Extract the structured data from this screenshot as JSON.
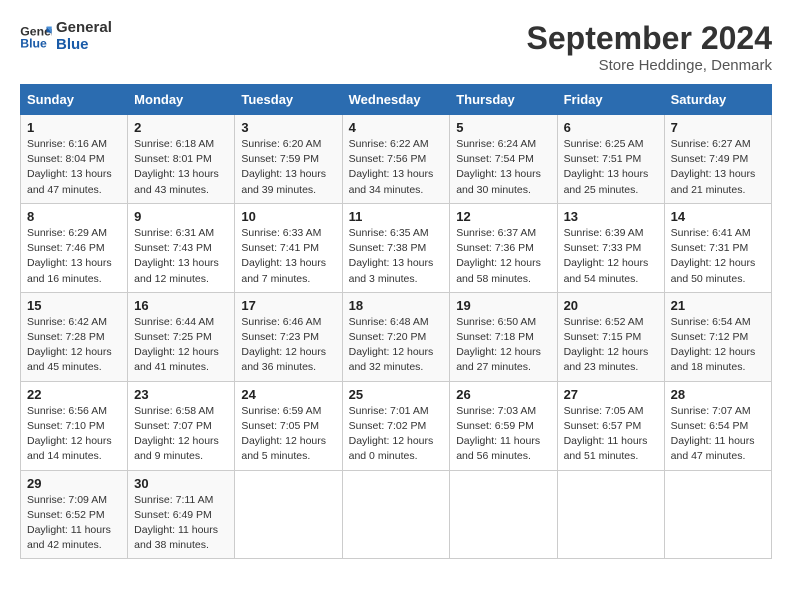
{
  "header": {
    "logo_line1": "General",
    "logo_line2": "Blue",
    "main_title": "September 2024",
    "subtitle": "Store Heddinge, Denmark"
  },
  "columns": [
    "Sunday",
    "Monday",
    "Tuesday",
    "Wednesday",
    "Thursday",
    "Friday",
    "Saturday"
  ],
  "weeks": [
    [
      {
        "day": "1",
        "sunrise": "6:16 AM",
        "sunset": "8:04 PM",
        "daylight": "13 hours and 47 minutes."
      },
      {
        "day": "2",
        "sunrise": "6:18 AM",
        "sunset": "8:01 PM",
        "daylight": "13 hours and 43 minutes."
      },
      {
        "day": "3",
        "sunrise": "6:20 AM",
        "sunset": "7:59 PM",
        "daylight": "13 hours and 39 minutes."
      },
      {
        "day": "4",
        "sunrise": "6:22 AM",
        "sunset": "7:56 PM",
        "daylight": "13 hours and 34 minutes."
      },
      {
        "day": "5",
        "sunrise": "6:24 AM",
        "sunset": "7:54 PM",
        "daylight": "13 hours and 30 minutes."
      },
      {
        "day": "6",
        "sunrise": "6:25 AM",
        "sunset": "7:51 PM",
        "daylight": "13 hours and 25 minutes."
      },
      {
        "day": "7",
        "sunrise": "6:27 AM",
        "sunset": "7:49 PM",
        "daylight": "13 hours and 21 minutes."
      }
    ],
    [
      {
        "day": "8",
        "sunrise": "6:29 AM",
        "sunset": "7:46 PM",
        "daylight": "13 hours and 16 minutes."
      },
      {
        "day": "9",
        "sunrise": "6:31 AM",
        "sunset": "7:43 PM",
        "daylight": "13 hours and 12 minutes."
      },
      {
        "day": "10",
        "sunrise": "6:33 AM",
        "sunset": "7:41 PM",
        "daylight": "13 hours and 7 minutes."
      },
      {
        "day": "11",
        "sunrise": "6:35 AM",
        "sunset": "7:38 PM",
        "daylight": "13 hours and 3 minutes."
      },
      {
        "day": "12",
        "sunrise": "6:37 AM",
        "sunset": "7:36 PM",
        "daylight": "12 hours and 58 minutes."
      },
      {
        "day": "13",
        "sunrise": "6:39 AM",
        "sunset": "7:33 PM",
        "daylight": "12 hours and 54 minutes."
      },
      {
        "day": "14",
        "sunrise": "6:41 AM",
        "sunset": "7:31 PM",
        "daylight": "12 hours and 50 minutes."
      }
    ],
    [
      {
        "day": "15",
        "sunrise": "6:42 AM",
        "sunset": "7:28 PM",
        "daylight": "12 hours and 45 minutes."
      },
      {
        "day": "16",
        "sunrise": "6:44 AM",
        "sunset": "7:25 PM",
        "daylight": "12 hours and 41 minutes."
      },
      {
        "day": "17",
        "sunrise": "6:46 AM",
        "sunset": "7:23 PM",
        "daylight": "12 hours and 36 minutes."
      },
      {
        "day": "18",
        "sunrise": "6:48 AM",
        "sunset": "7:20 PM",
        "daylight": "12 hours and 32 minutes."
      },
      {
        "day": "19",
        "sunrise": "6:50 AM",
        "sunset": "7:18 PM",
        "daylight": "12 hours and 27 minutes."
      },
      {
        "day": "20",
        "sunrise": "6:52 AM",
        "sunset": "7:15 PM",
        "daylight": "12 hours and 23 minutes."
      },
      {
        "day": "21",
        "sunrise": "6:54 AM",
        "sunset": "7:12 PM",
        "daylight": "12 hours and 18 minutes."
      }
    ],
    [
      {
        "day": "22",
        "sunrise": "6:56 AM",
        "sunset": "7:10 PM",
        "daylight": "12 hours and 14 minutes."
      },
      {
        "day": "23",
        "sunrise": "6:58 AM",
        "sunset": "7:07 PM",
        "daylight": "12 hours and 9 minutes."
      },
      {
        "day": "24",
        "sunrise": "6:59 AM",
        "sunset": "7:05 PM",
        "daylight": "12 hours and 5 minutes."
      },
      {
        "day": "25",
        "sunrise": "7:01 AM",
        "sunset": "7:02 PM",
        "daylight": "12 hours and 0 minutes."
      },
      {
        "day": "26",
        "sunrise": "7:03 AM",
        "sunset": "6:59 PM",
        "daylight": "11 hours and 56 minutes."
      },
      {
        "day": "27",
        "sunrise": "7:05 AM",
        "sunset": "6:57 PM",
        "daylight": "11 hours and 51 minutes."
      },
      {
        "day": "28",
        "sunrise": "7:07 AM",
        "sunset": "6:54 PM",
        "daylight": "11 hours and 47 minutes."
      }
    ],
    [
      {
        "day": "29",
        "sunrise": "7:09 AM",
        "sunset": "6:52 PM",
        "daylight": "11 hours and 42 minutes."
      },
      {
        "day": "30",
        "sunrise": "7:11 AM",
        "sunset": "6:49 PM",
        "daylight": "11 hours and 38 minutes."
      },
      null,
      null,
      null,
      null,
      null
    ]
  ]
}
